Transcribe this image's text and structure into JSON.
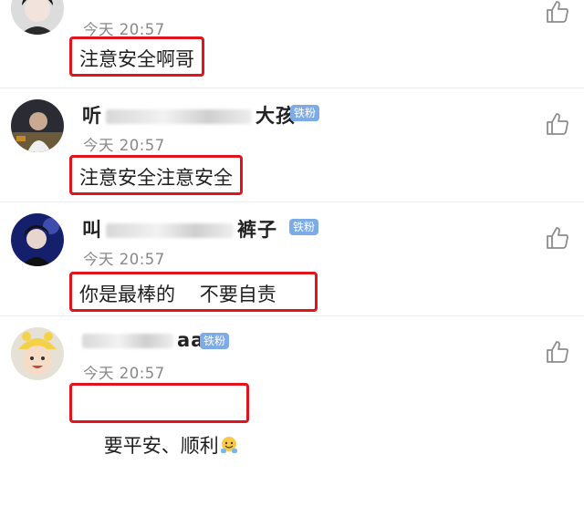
{
  "comments": [
    {
      "username": "　",
      "time": "今天 20:57",
      "text": "注意安全啊哥",
      "badge": ""
    },
    {
      "username": "听",
      "username_tail": "大孩",
      "time": "今天 20:57",
      "text": "注意安全注意安全",
      "badge": "铁粉"
    },
    {
      "username": "叫",
      "username_tail": "裤子",
      "time": "今天 20:57",
      "text": "你是最棒的    不要自责",
      "badge": "铁粉"
    },
    {
      "username": "",
      "username_tail": "aa",
      "time": "今天 20:57",
      "text": "要平安、顺利",
      "badge": "铁粉"
    }
  ],
  "icons": {
    "like": "thumbs-up-icon",
    "emoji": "hugging-face-emoji"
  },
  "colors": {
    "highlight_border": "#e1141c",
    "badge_bg": "#7dabe6",
    "timestamp": "#888888"
  }
}
